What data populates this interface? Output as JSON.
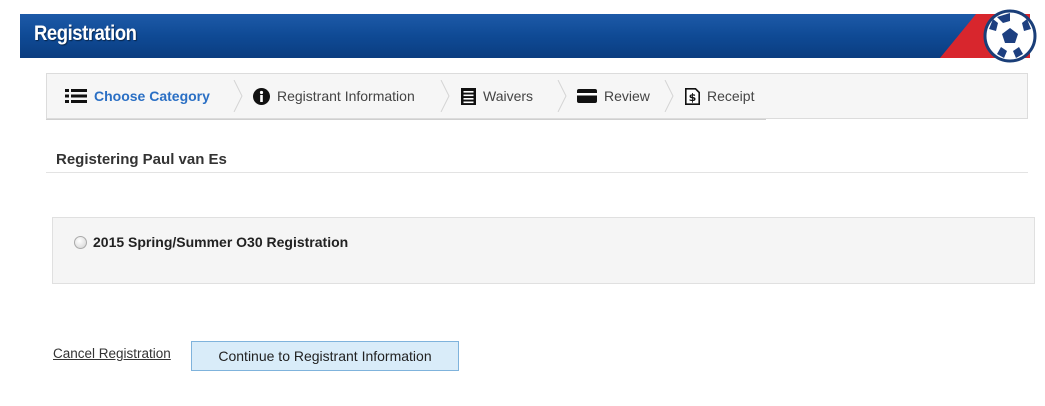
{
  "header": {
    "title": "Registration"
  },
  "steps": [
    {
      "label": "Choose Category",
      "icon": "list-icon",
      "active": true
    },
    {
      "label": "Registrant Information",
      "icon": "info-circle-icon",
      "active": false
    },
    {
      "label": "Waivers",
      "icon": "document-icon",
      "active": false
    },
    {
      "label": "Review",
      "icon": "credit-card-icon",
      "active": false
    },
    {
      "label": "Receipt",
      "icon": "receipt-dollar-icon",
      "active": false
    }
  ],
  "registering": {
    "title": "Registering Paul van Es"
  },
  "options": [
    {
      "label": "2015 Spring/Summer O30 Registration",
      "selected": false
    }
  ],
  "actions": {
    "cancel_label": "Cancel Registration",
    "continue_label": "Continue to Registrant Information"
  },
  "colors": {
    "header_blue": "#0f4a95",
    "header_red": "#d8262d",
    "active_step": "#2a6fc4",
    "button_bg": "#d9ecf9",
    "button_border": "#7fb3dc"
  }
}
